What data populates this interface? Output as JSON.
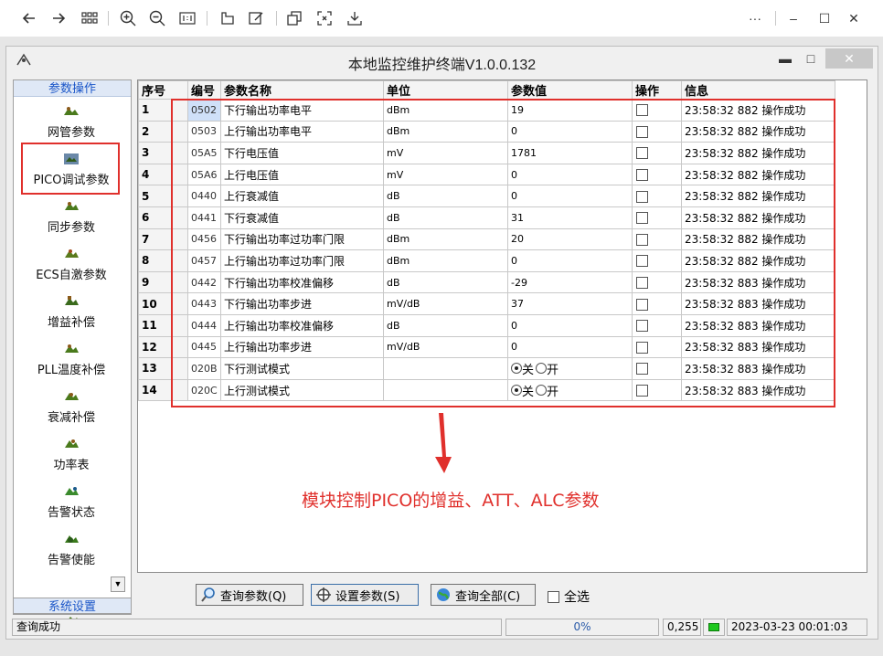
{
  "viewer": {
    "toolbar_icons": [
      "back-icon",
      "forward-icon",
      "grid-icon",
      "zoom-in-icon",
      "zoom-out-icon",
      "actual-size-icon",
      "rotate-icon",
      "edit-icon",
      "copy-icon",
      "fit-icon",
      "save-icon"
    ],
    "more_label": "···",
    "minimize_label": "–",
    "maximize_label": "☐",
    "close_label": "✕"
  },
  "app": {
    "title": "本地监控维护终端V1.0.0.132",
    "minimize_label": "▬",
    "restore_label": "□",
    "close_label": "✕"
  },
  "sidebar": {
    "header": "参数操作",
    "items": [
      {
        "label": "网管参数",
        "icon": "network-icon"
      },
      {
        "label": "PICO调试参数",
        "icon": "pico-icon"
      },
      {
        "label": "同步参数",
        "icon": "sync-icon"
      },
      {
        "label": "ECS自激参数",
        "icon": "ecs-icon"
      },
      {
        "label": "增益补偿",
        "icon": "gain-icon"
      },
      {
        "label": "PLL温度补偿",
        "icon": "pll-icon"
      },
      {
        "label": "衰减补偿",
        "icon": "attenuation-icon"
      },
      {
        "label": "功率表",
        "icon": "power-icon"
      },
      {
        "label": "告警状态",
        "icon": "alarm-state-icon"
      },
      {
        "label": "告警使能",
        "icon": "alarm-enable-icon"
      }
    ],
    "footer": "系统设置"
  },
  "grid": {
    "columns": [
      "序号",
      "编号",
      "参数名称",
      "单位",
      "参数值",
      "操作",
      "信息"
    ],
    "rows": [
      {
        "seq": "1",
        "code": "0502",
        "name": "下行输出功率电平",
        "unit": "dBm",
        "value": "19",
        "info": "23:58:32 882 操作成功"
      },
      {
        "seq": "2",
        "code": "0503",
        "name": "上行输出功率电平",
        "unit": "dBm",
        "value": "0",
        "info": "23:58:32 882 操作成功"
      },
      {
        "seq": "3",
        "code": "05A5",
        "name": "下行电压值",
        "unit": "mV",
        "value": "1781",
        "info": "23:58:32 882 操作成功"
      },
      {
        "seq": "4",
        "code": "05A6",
        "name": "上行电压值",
        "unit": "mV",
        "value": "0",
        "info": "23:58:32 882 操作成功"
      },
      {
        "seq": "5",
        "code": "0440",
        "name": "上行衰减值",
        "unit": "dB",
        "value": "0",
        "info": "23:58:32 882 操作成功"
      },
      {
        "seq": "6",
        "code": "0441",
        "name": "下行衰减值",
        "unit": "dB",
        "value": "31",
        "info": "23:58:32 882 操作成功"
      },
      {
        "seq": "7",
        "code": "0456",
        "name": "下行输出功率过功率门限",
        "unit": "dBm",
        "value": "20",
        "info": "23:58:32 882 操作成功"
      },
      {
        "seq": "8",
        "code": "0457",
        "name": "上行输出功率过功率门限",
        "unit": "dBm",
        "value": "0",
        "info": "23:58:32 882 操作成功"
      },
      {
        "seq": "9",
        "code": "0442",
        "name": "下行输出功率校准偏移",
        "unit": "dB",
        "value": "-29",
        "info": "23:58:32 883 操作成功"
      },
      {
        "seq": "10",
        "code": "0443",
        "name": "下行输出功率步进",
        "unit": "mV/dB",
        "value": "37",
        "info": "23:58:32 883 操作成功"
      },
      {
        "seq": "11",
        "code": "0444",
        "name": "上行输出功率校准偏移",
        "unit": "dB",
        "value": "0",
        "info": "23:58:32 883 操作成功"
      },
      {
        "seq": "12",
        "code": "0445",
        "name": "上行输出功率步进",
        "unit": "mV/dB",
        "value": "0",
        "info": "23:58:32 883 操作成功"
      },
      {
        "seq": "13",
        "code": "020B",
        "name": "下行测试模式",
        "unit": "",
        "value": "",
        "radio_off": "关",
        "radio_on": "开",
        "info": "23:58:32 883 操作成功"
      },
      {
        "seq": "14",
        "code": "020C",
        "name": "上行测试模式",
        "unit": "",
        "value": "",
        "radio_off": "关",
        "radio_on": "开",
        "info": "23:58:32 883 操作成功"
      }
    ]
  },
  "buttons": {
    "query": "查询参数(Q)",
    "set": "设置参数(S)",
    "query_all": "查询全部(C)",
    "select_all": "全选"
  },
  "status": {
    "message": "查询成功",
    "progress": "0%",
    "coords": "0,255",
    "datetime": "2023-03-23 00:01:03",
    "led_color": "#1ec81e"
  },
  "annotation": {
    "text": "模块控制PICO的增益、ATT、ALC参数",
    "color": "#e0302c"
  }
}
